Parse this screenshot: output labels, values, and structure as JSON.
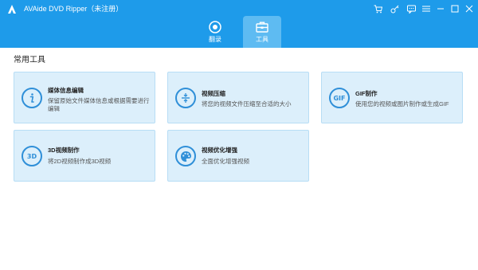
{
  "window": {
    "title": "AVAide DVD Ripper（未注册）"
  },
  "title_bar_icons": [
    "cart-icon",
    "key-icon",
    "chat-icon",
    "menu-icon",
    "minimize-icon",
    "maximize-icon",
    "close-icon"
  ],
  "tabs": [
    {
      "label": "翻录",
      "icon": "record-icon",
      "active": false
    },
    {
      "label": "工具",
      "icon": "toolbox-icon",
      "active": true
    }
  ],
  "section": {
    "title": "常用工具"
  },
  "tools": [
    {
      "id": "media-info",
      "title": "媒体信息编辑",
      "desc": "保留原始文件媒体信息或根据需要进行编辑",
      "icon": "info-icon"
    },
    {
      "id": "compress",
      "title": "视频压缩",
      "desc": "将您的视频文件压缩至合适的大小",
      "icon": "compress-icon"
    },
    {
      "id": "gif",
      "title": "GIF制作",
      "desc": "使用您的视频或图片制作或生成GIF",
      "icon": "gif-icon",
      "icon_text": "GIF"
    },
    {
      "id": "3d",
      "title": "3D视频制作",
      "desc": "将2D视频制作成3D视频",
      "icon": "3d-icon",
      "icon_text": "3D"
    },
    {
      "id": "enhance",
      "title": "视频优化增强",
      "desc": "全面优化增强视频",
      "icon": "palette-icon"
    }
  ],
  "colors": {
    "header": "#1E9BEA",
    "active_tab": "#5EBBF2",
    "card_bg": "#DCEFFB",
    "card_border": "#B7DDF5",
    "icon_blue": "#2F8FD8"
  }
}
